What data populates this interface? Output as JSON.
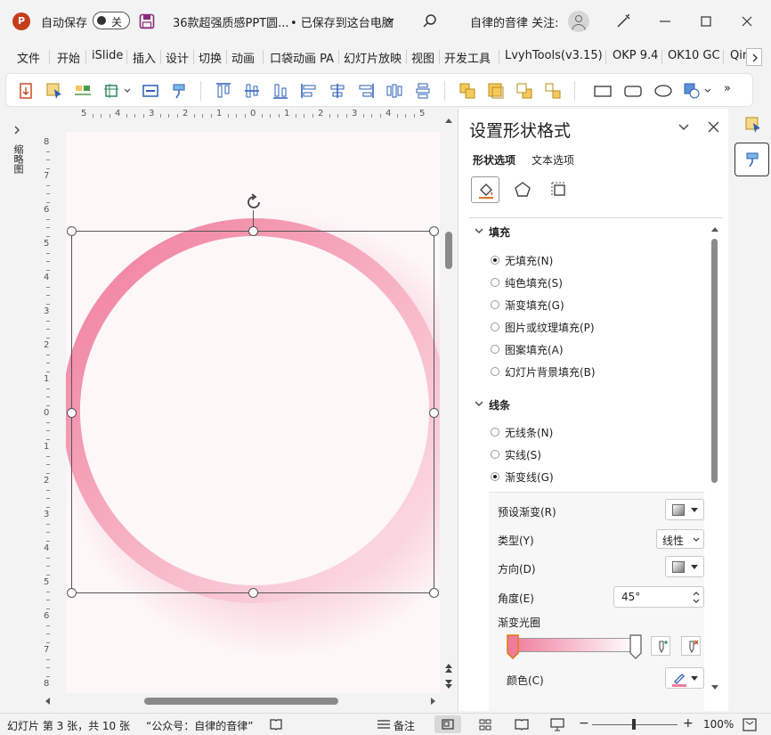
{
  "titlebar": {
    "autosave_label": "自动保存",
    "autosave_state": "关",
    "doc_title": "36款超强质感PPT圆...",
    "save_status": "• 已保存到这台电脑",
    "user_label": "自律的音律 关注:"
  },
  "menu": [
    "文件",
    "开始",
    "iSlide",
    "插入",
    "设计",
    "切换",
    "动画",
    "口袋动画 PA",
    "幻灯片放映",
    "视图",
    "开发工具",
    "LvyhTools(v3.15)",
    "OKP 9.4",
    "OK10 GC",
    "Qin"
  ],
  "leftstrip": {
    "thumbnails_label": "缩略图"
  },
  "ruler": {
    "top": [
      "5",
      "4",
      "3",
      "2",
      "1",
      "0",
      "1",
      "2",
      "3",
      "4",
      "5"
    ],
    "left": [
      "8",
      "7",
      "6",
      "5",
      "4",
      "3",
      "2",
      "1",
      "0",
      "1",
      "2",
      "3",
      "4",
      "5",
      "6",
      "7",
      "8"
    ]
  },
  "pane": {
    "title": "设置形状格式",
    "tabs": [
      "形状选项",
      "文本选项"
    ],
    "fill": {
      "header": "填充",
      "options": [
        "无填充(N)",
        "纯色填充(S)",
        "渐变填充(G)",
        "图片或纹理填充(P)",
        "图案填充(A)",
        "幻灯片背景填充(B)"
      ],
      "selected": 0
    },
    "line": {
      "header": "线条",
      "options": [
        "无线条(N)",
        "实线(S)",
        "渐变线(G)"
      ],
      "selected": 2
    },
    "gradient": {
      "preset_label": "预设渐变(R)",
      "type_label": "类型(Y)",
      "type_value": "线性",
      "direction_label": "方向(D)",
      "angle_label": "角度(E)",
      "angle_value": "45°",
      "stops_label": "渐变光圈",
      "color_label": "颜色(C)"
    }
  },
  "status": {
    "slide_info": "幻灯片 第 3 张，共 10 张",
    "note": "“公众号：自律的音律”",
    "notes_button": "备注",
    "zoom": "100%"
  },
  "colors": {
    "accent": "#f48fab",
    "app_red": "#c43e1c",
    "ring_pink": "#f29ab0"
  }
}
